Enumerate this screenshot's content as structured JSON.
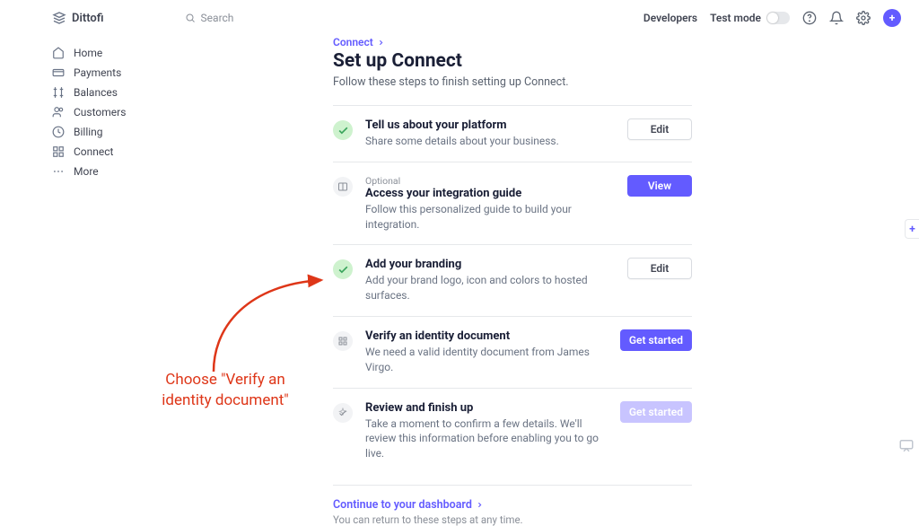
{
  "header": {
    "brand": "Dittofi",
    "search_placeholder": "Search",
    "developers": "Developers",
    "test_mode": "Test mode"
  },
  "sidebar": {
    "items": [
      {
        "label": "Home"
      },
      {
        "label": "Payments"
      },
      {
        "label": "Balances"
      },
      {
        "label": "Customers"
      },
      {
        "label": "Billing"
      },
      {
        "label": "Connect"
      },
      {
        "label": "More"
      }
    ]
  },
  "breadcrumb": "Connect",
  "page_title": "Set up Connect",
  "subtitle": "Follow these steps to finish setting up Connect.",
  "tasks": [
    {
      "status": "done",
      "title": "Tell us about your platform",
      "desc": "Share some details about your business.",
      "button": {
        "label": "Edit",
        "style": "light"
      }
    },
    {
      "status": "pending",
      "optional": "Optional",
      "title": "Access your integration guide",
      "desc": "Follow this personalized guide to build your integration.",
      "button": {
        "label": "View",
        "style": "primary"
      }
    },
    {
      "status": "done",
      "title": "Add your branding",
      "desc": "Add your brand logo, icon and colors to hosted surfaces.",
      "button": {
        "label": "Edit",
        "style": "light"
      }
    },
    {
      "status": "pending",
      "title": "Verify an identity document",
      "desc": "We need a valid identity document from James Virgo.",
      "button": {
        "label": "Get started",
        "style": "primary"
      }
    },
    {
      "status": "pending",
      "title": "Review and finish up",
      "desc": "Take a moment to confirm a few details. We'll review this information before enabling you to go live.",
      "button": {
        "label": "Get started",
        "style": "disabled"
      }
    }
  ],
  "continue_link": "Continue to your dashboard",
  "continue_sub": "You can return to these steps at any time.",
  "annotation_line1": "Choose \"Verify an",
  "annotation_line2": "identity document\"",
  "icons": {
    "help": "?",
    "plus": "+"
  }
}
